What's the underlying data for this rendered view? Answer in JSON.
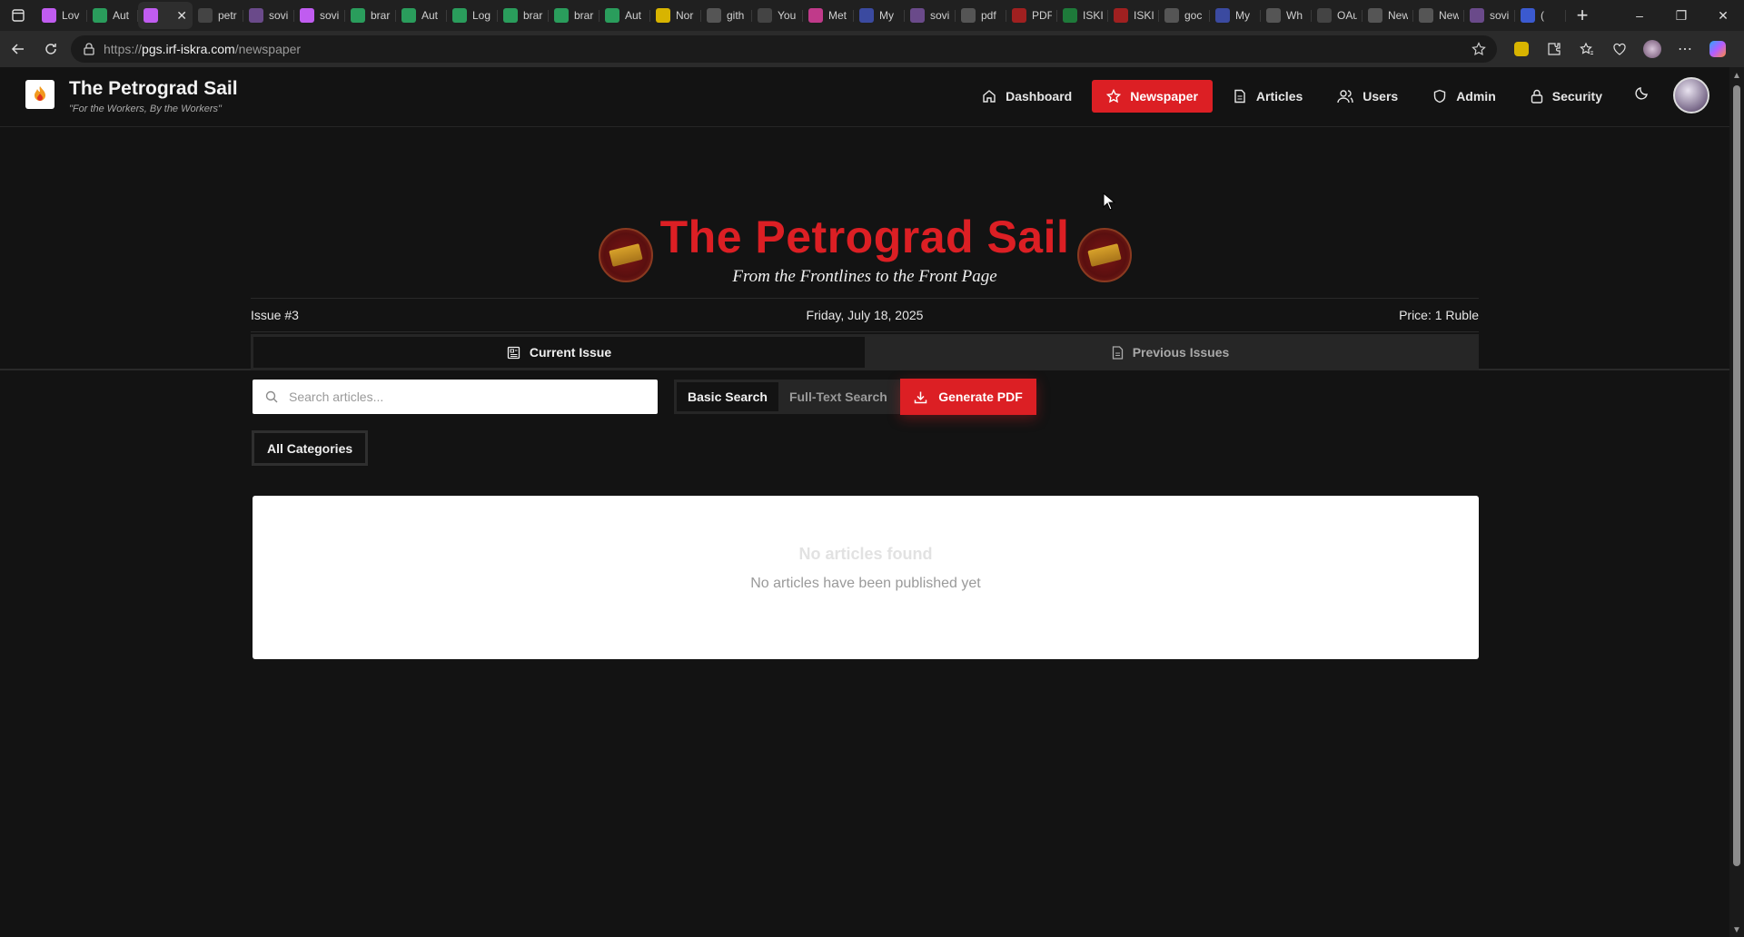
{
  "browser": {
    "tabs": [
      {
        "label": "Lov",
        "color": "#c05cf0"
      },
      {
        "label": "Aut",
        "color": "#2a9d5c"
      },
      {
        "label": "",
        "color": "#c05cf0",
        "active": true
      },
      {
        "label": "petr",
        "color": "#444"
      },
      {
        "label": "sovi",
        "color": "#6a4a8a"
      },
      {
        "label": "sovi",
        "color": "#c05cf0"
      },
      {
        "label": "brar",
        "color": "#2a9d5c"
      },
      {
        "label": "Aut",
        "color": "#2a9d5c"
      },
      {
        "label": "Log",
        "color": "#2a9d5c"
      },
      {
        "label": "brar",
        "color": "#2a9d5c"
      },
      {
        "label": "brar",
        "color": "#2a9d5c"
      },
      {
        "label": "Aut",
        "color": "#2a9d5c"
      },
      {
        "label": "Nor",
        "color": "#d8b400"
      },
      {
        "label": "gith",
        "color": "#555"
      },
      {
        "label": "You",
        "color": "#444"
      },
      {
        "label": "Met",
        "color": "#c03a8a"
      },
      {
        "label": "My",
        "color": "#3b4aa0"
      },
      {
        "label": "sovi",
        "color": "#6a4a8a"
      },
      {
        "label": "pdf",
        "color": "#555"
      },
      {
        "label": "PDF",
        "color": "#a02020"
      },
      {
        "label": "ISKI",
        "color": "#1e7a3a"
      },
      {
        "label": "ISKI",
        "color": "#a02020"
      },
      {
        "label": "goc",
        "color": "#555"
      },
      {
        "label": "My",
        "color": "#3b4aa0"
      },
      {
        "label": "Wh",
        "color": "#555"
      },
      {
        "label": "OAu",
        "color": "#444"
      },
      {
        "label": "New",
        "color": "#555"
      },
      {
        "label": "New",
        "color": "#555"
      },
      {
        "label": "sovi",
        "color": "#6a4a8a"
      },
      {
        "label": "(",
        "color": "#3b5ad0"
      }
    ],
    "url_prefix": "https://",
    "url_host": "pgs.irf-iskra.com",
    "url_path": "/newspaper"
  },
  "header": {
    "brand_title": "The Petrograd Sail",
    "brand_tagline": "\"For the Workers, By the Workers\"",
    "nav": [
      {
        "label": "Dashboard",
        "icon": "home-icon"
      },
      {
        "label": "Newspaper",
        "icon": "star-icon",
        "active": true
      },
      {
        "label": "Articles",
        "icon": "document-icon"
      },
      {
        "label": "Users",
        "icon": "users-icon"
      },
      {
        "label": "Admin",
        "icon": "shield-icon"
      },
      {
        "label": "Security",
        "icon": "lock-icon"
      }
    ]
  },
  "masthead": {
    "title": "The Petrograd Sail",
    "subtitle": "From the Frontlines to the Front Page",
    "issue": "Issue #3",
    "date": "Friday, July 18, 2025",
    "price": "Price: 1 Ruble"
  },
  "tabs": {
    "current": "Current Issue",
    "previous": "Previous Issues"
  },
  "search": {
    "placeholder": "Search articles...",
    "value": "",
    "basic": "Basic Search",
    "fulltext": "Full-Text Search",
    "generate_pdf": "Generate PDF"
  },
  "filters": {
    "category": "All Categories"
  },
  "empty": {
    "title": "No articles found",
    "message": "No articles have been published yet"
  },
  "colors": {
    "accent": "#dc1f24",
    "background": "#131313",
    "panel": "#262626"
  }
}
